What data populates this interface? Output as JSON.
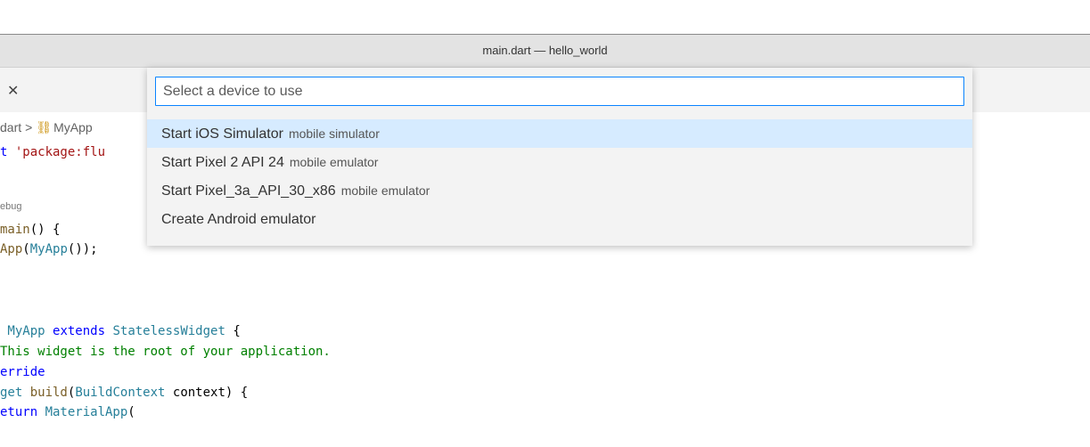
{
  "window": {
    "title": "main.dart — hello_world"
  },
  "tab": {
    "close_glyph": "✕"
  },
  "breadcrumb": {
    "file": "dart",
    "separator": ">",
    "symbol_icon": "class-icon",
    "symbol": "MyApp"
  },
  "codelens": {
    "text": "ebug"
  },
  "code": {
    "import_kw": "t ",
    "import_str": "'package:flu",
    "main_fn": "main",
    "main_rest": "() {",
    "runapp_fn": "App",
    "runapp_open": "(",
    "runapp_arg": "MyApp",
    "runapp_close": "());",
    "class_name": " MyApp ",
    "extends_kw": "extends",
    "space": " ",
    "super_cls": "StatelessWidget",
    "class_open": " {",
    "comment": "This widget is the root of your application.",
    "annotation": "erride",
    "build_ret": "get ",
    "build_fn": "build",
    "build_open": "(",
    "build_type": "BuildContext",
    "build_rest": " context) {",
    "return_kw": "eturn ",
    "return_cls": "MaterialApp",
    "return_rest": "("
  },
  "quick_pick": {
    "placeholder": "Select a device to use",
    "items": [
      {
        "label": "Start iOS Simulator",
        "description": "mobile simulator",
        "selected": true
      },
      {
        "label": "Start Pixel 2 API 24",
        "description": "mobile emulator",
        "selected": false
      },
      {
        "label": "Start Pixel_3a_API_30_x86",
        "description": "mobile emulator",
        "selected": false
      },
      {
        "label": "Create Android emulator",
        "description": "",
        "selected": false
      }
    ]
  },
  "colors": {
    "selection": "#d6ebff",
    "focus_border": "#0a84ff",
    "keyword": "#0000ff",
    "comment": "#008000",
    "string": "#a31515",
    "type": "#267f99",
    "function": "#795e26"
  }
}
